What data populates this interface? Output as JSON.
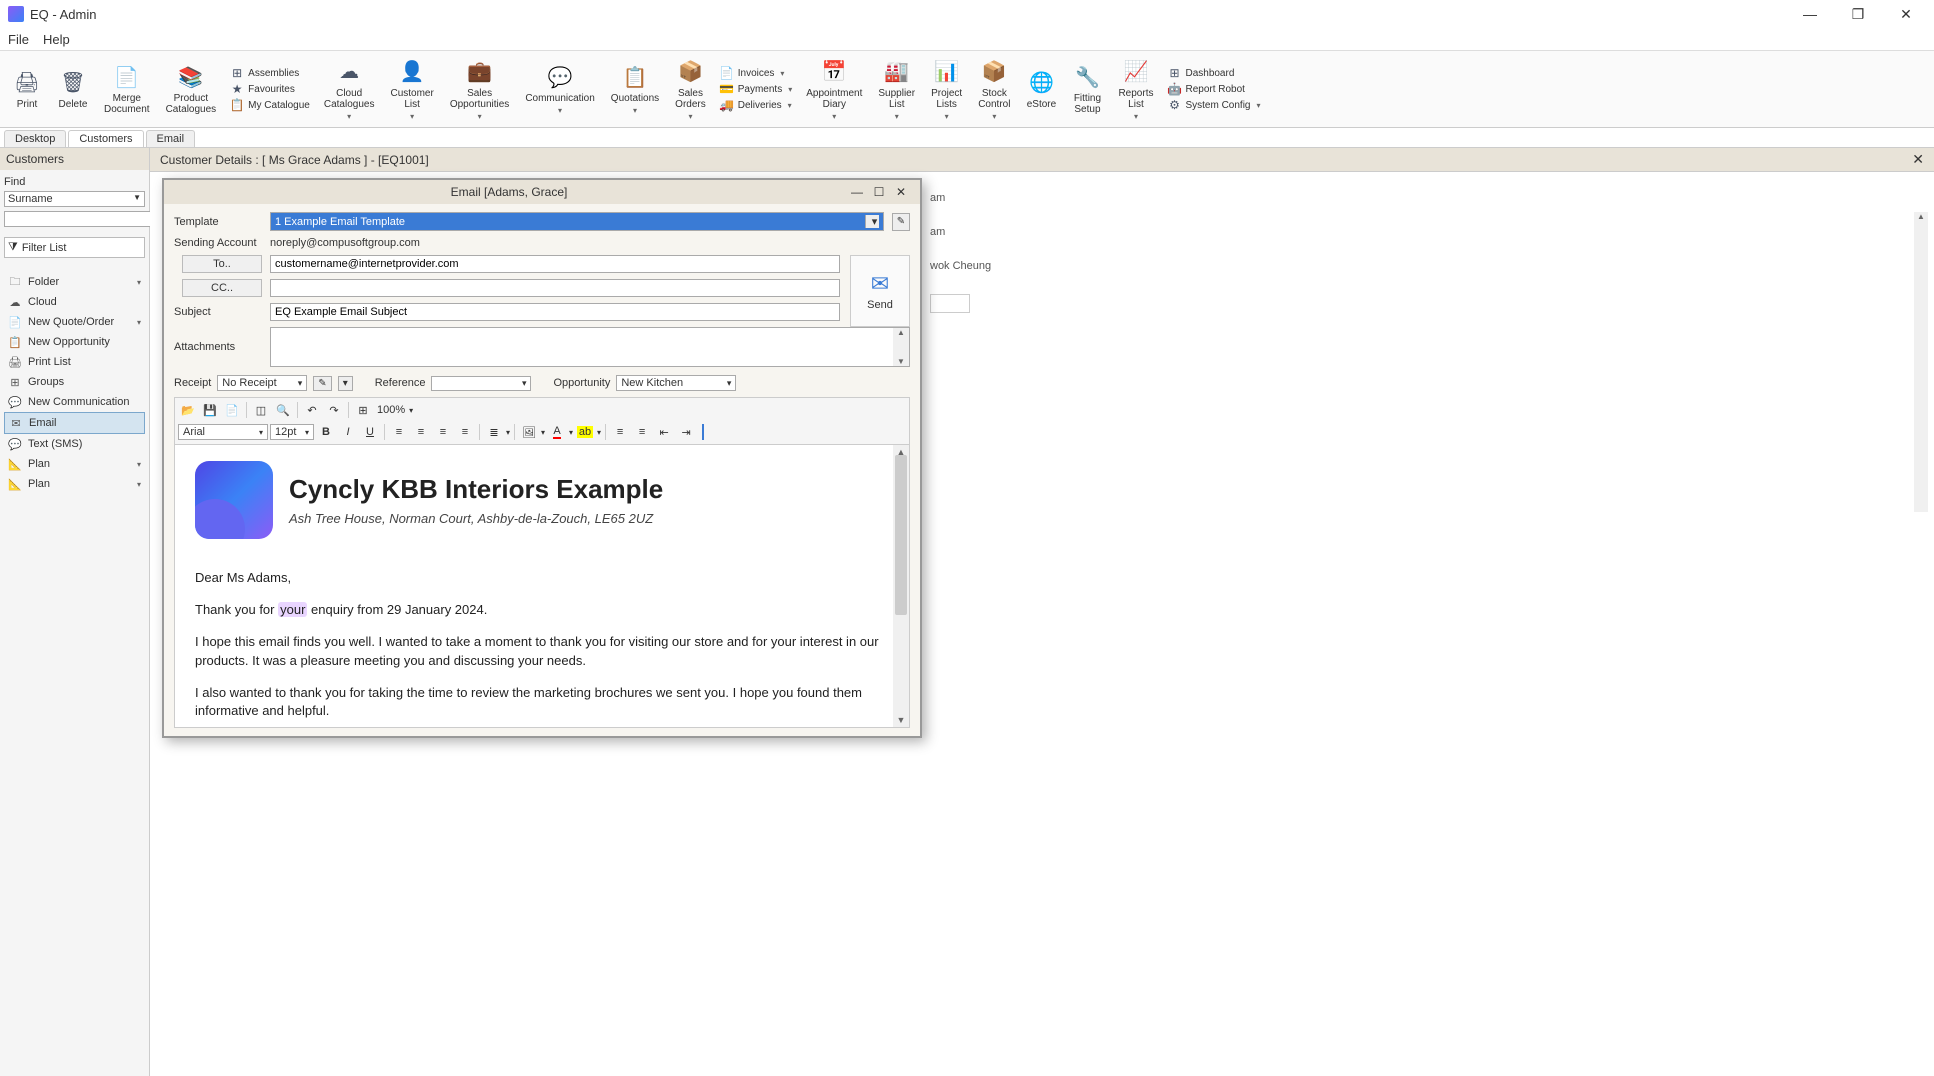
{
  "app": {
    "title": "EQ - Admin",
    "menu": [
      "File",
      "Help"
    ]
  },
  "window_controls": {
    "min": "—",
    "max": "❐",
    "close": "✕"
  },
  "ribbon": {
    "main_buttons": [
      {
        "id": "print",
        "label": "Print",
        "glyph": "🖨"
      },
      {
        "id": "delete",
        "label": "Delete",
        "glyph": "🗑"
      },
      {
        "id": "merge-doc",
        "label": "Merge\nDocument",
        "glyph": "📄"
      },
      {
        "id": "prod-cat",
        "label": "Product\nCatalogues",
        "glyph": "📚"
      }
    ],
    "assembly_stack": [
      {
        "id": "assemblies",
        "label": "Assemblies",
        "glyph": "⊞"
      },
      {
        "id": "favourites",
        "label": "Favourites",
        "glyph": "★"
      },
      {
        "id": "my-catalogue",
        "label": "My Catalogue",
        "glyph": "📋"
      }
    ],
    "mid_buttons": [
      {
        "id": "cloud-cat",
        "label": "Cloud\nCatalogues",
        "glyph": "☁",
        "caret": true
      },
      {
        "id": "cust-list",
        "label": "Customer\nList",
        "glyph": "👤",
        "caret": true
      },
      {
        "id": "sales-opp",
        "label": "Sales\nOpportunities",
        "glyph": "💼",
        "caret": true
      },
      {
        "id": "communication",
        "label": "Communication",
        "glyph": "💬",
        "caret": true
      },
      {
        "id": "quotations",
        "label": "Quotations",
        "glyph": "📋",
        "caret": true
      },
      {
        "id": "sales-orders",
        "label": "Sales\nOrders",
        "glyph": "📦",
        "caret": true
      }
    ],
    "finance_stack": [
      {
        "id": "invoices",
        "label": "Invoices",
        "glyph": "📄",
        "caret": true
      },
      {
        "id": "payments",
        "label": "Payments",
        "glyph": "💳",
        "caret": true
      },
      {
        "id": "deliveries",
        "label": "Deliveries",
        "glyph": "🚚",
        "caret": true
      }
    ],
    "tail_buttons": [
      {
        "id": "appt-diary",
        "label": "Appointment\nDiary",
        "glyph": "📅",
        "caret": true
      },
      {
        "id": "supplier-list",
        "label": "Supplier\nList",
        "glyph": "🏭",
        "caret": true
      },
      {
        "id": "project-lists",
        "label": "Project\nLists",
        "glyph": "📊",
        "caret": true
      },
      {
        "id": "stock-control",
        "label": "Stock\nControl",
        "glyph": "📦",
        "caret": true
      },
      {
        "id": "estore",
        "label": "eStore",
        "glyph": "🌐"
      },
      {
        "id": "fitting-setup",
        "label": "Fitting\nSetup",
        "glyph": "🔧"
      },
      {
        "id": "reports-list",
        "label": "Reports\nList",
        "glyph": "📈",
        "caret": true
      }
    ],
    "system_stack": [
      {
        "id": "dashboard",
        "label": "Dashboard",
        "glyph": "⊞"
      },
      {
        "id": "report-robot",
        "label": "Report Robot",
        "glyph": "🤖"
      },
      {
        "id": "system-config",
        "label": "System Config",
        "glyph": "⚙",
        "caret": true
      }
    ]
  },
  "tabs": [
    {
      "id": "desktop",
      "label": "Desktop"
    },
    {
      "id": "customers",
      "label": "Customers"
    },
    {
      "id": "email",
      "label": "Email"
    }
  ],
  "left_panel": {
    "header": "Customers",
    "find_label": "Find",
    "find_field": "Surname",
    "search_value": "",
    "filter_button": "Filter List",
    "nav": [
      {
        "id": "folder",
        "label": "Folder",
        "glyph": "🗀",
        "caret": true
      },
      {
        "id": "cloud",
        "label": "Cloud",
        "glyph": "☁"
      },
      {
        "id": "new-quote",
        "label": "New Quote/Order",
        "glyph": "📄",
        "caret": true
      },
      {
        "id": "new-opp",
        "label": "New Opportunity",
        "glyph": "📋"
      },
      {
        "id": "print-list",
        "label": "Print List",
        "glyph": "🖨"
      },
      {
        "id": "groups",
        "label": "Groups",
        "glyph": "⊞"
      },
      {
        "id": "new-comm",
        "label": "New Communication",
        "glyph": "💬"
      },
      {
        "id": "email",
        "label": "Email",
        "glyph": "✉",
        "active": true
      },
      {
        "id": "text-sms",
        "label": "Text (SMS)",
        "glyph": "💬"
      },
      {
        "id": "plan1",
        "label": "Plan",
        "glyph": "📐",
        "caret": true
      },
      {
        "id": "plan2",
        "label": "Plan",
        "glyph": "📐",
        "caret": true
      }
    ]
  },
  "details": {
    "header": "Customer Details : [ Ms Grace Adams ]  -  [EQ1001]",
    "bg_text": [
      "am",
      "am",
      "wok Cheung"
    ]
  },
  "email_dialog": {
    "title": "Email [Adams, Grace]",
    "template_label": "Template",
    "template_value": "1 Example Email Template",
    "sending_account_label": "Sending Account",
    "sending_account_value": "noreply@compusoftgroup.com",
    "to_label": "To..",
    "to_value": "customername@internetprovider.com",
    "cc_label": "CC..",
    "cc_value": "",
    "subject_label": "Subject",
    "subject_value": "EQ Example Email Subject",
    "attachments_label": "Attachments",
    "send_label": "Send",
    "receipt_label": "Receipt",
    "receipt_value": "No Receipt",
    "reference_label": "Reference",
    "reference_value": "",
    "opportunity_label": "Opportunity",
    "opportunity_value": "New Kitchen",
    "editor": {
      "font": "Arial",
      "size": "12pt",
      "zoom": "100%",
      "company_name": "Cyncly KBB Interiors Example",
      "company_address": "Ash Tree House, Norman Court, Ashby-de-la-Zouch, LE65 2UZ",
      "salutation": "Dear Ms Adams,",
      "para1_pre": "Thank you for ",
      "para1_highlight": "your",
      "para1_post": " enquiry from 29 January 2024.",
      "para2": "I hope this email finds you well. I wanted to take a moment to thank you for visiting our store and for your interest in our products. It was a pleasure meeting you and discussing your needs.",
      "para3": "I also wanted to thank you for taking the time to review the marketing brochures we sent you. I hope you found them informative and helpful."
    }
  }
}
